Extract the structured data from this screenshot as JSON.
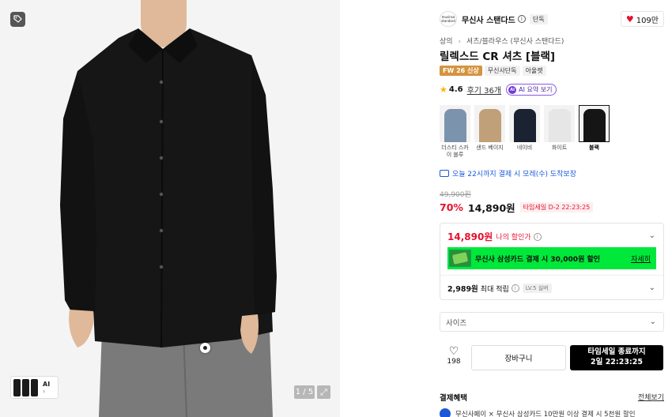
{
  "gallery": {
    "counter": "1 / 5",
    "thumb_label": "AI",
    "thumb_chevron": "›"
  },
  "brand": {
    "logo_text": "musinsa standard",
    "name": "무신사 스탠다드",
    "exclusive": "단독",
    "likes": "109만"
  },
  "breadcrumb": [
    "상의",
    "셔츠/블라우스 (무신사 스탠다드)"
  ],
  "product": {
    "title": "릴렉스드 CR 셔츠 [블랙]",
    "badges": [
      "FW 26 신상",
      "무신사단독",
      "아울렛"
    ]
  },
  "rating": {
    "score": "4.6",
    "reviews": "후기 36개",
    "ai_summary": "AI 요약 보기",
    "ai_badge": "AI"
  },
  "colors": [
    {
      "label": "더스티 스카이 블루",
      "color": "#7b93ad"
    },
    {
      "label": "샌드 베이지",
      "color": "#c0a078"
    },
    {
      "label": "네이비",
      "color": "#1b2333"
    },
    {
      "label": "화이트",
      "color": "#e6e6e6"
    },
    {
      "label": "블랙",
      "color": "#151515"
    }
  ],
  "delivery": "오늘 22시까지 결제 시 모레(수) 도착보장",
  "pricing": {
    "original": "49,900원",
    "discount": "70%",
    "price": "14,890원",
    "timesale": "타임세일 D-2 22:23:25"
  },
  "benefit": {
    "my_price": "14,890원",
    "my_price_label": "나의 할인가",
    "card_text": "무신사 삼성카드 결제 시 30,000원 할인",
    "card_detail": "자세히",
    "points_value": "2,989원",
    "points_label": "최대 적립",
    "level": "LV.5 실버"
  },
  "size_select": {
    "placeholder": "사이즈"
  },
  "actions": {
    "like_count": "198",
    "cart": "장바구니",
    "buy_line1": "타임세일 종료까지",
    "buy_line2": "2일 22:23:25"
  },
  "payment": {
    "title": "결제혜택",
    "view_all": "전체보기",
    "message": "무신사페이 × 무신사 삼성카드 10만원 이상 결제 시 5천원 할인"
  },
  "theme": {
    "accent_red": "#e8112d",
    "link_blue": "#1a58d8",
    "banner_green": "#00e83a"
  }
}
